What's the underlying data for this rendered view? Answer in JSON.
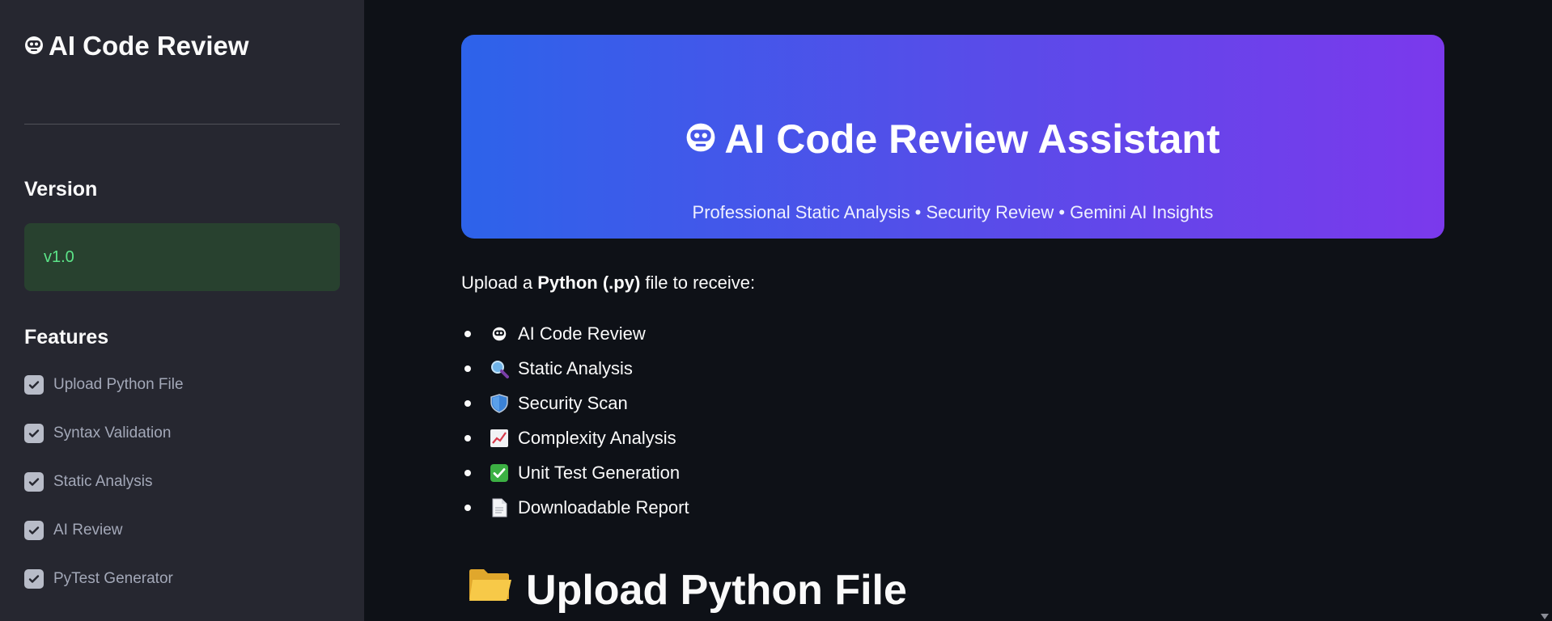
{
  "sidebar": {
    "title": "AI Code Review",
    "version_heading": "Version",
    "version_value": "v1.0",
    "features_heading": "Features",
    "features": [
      {
        "label": "Upload Python File",
        "checked": true
      },
      {
        "label": "Syntax Validation",
        "checked": true
      },
      {
        "label": "Static Analysis",
        "checked": true
      },
      {
        "label": "AI Review",
        "checked": true
      },
      {
        "label": "PyTest Generator",
        "checked": true
      }
    ]
  },
  "main": {
    "banner_title": "AI Code Review Assistant",
    "banner_subtitle": "Professional Static Analysis • Security Review • Gemini AI Insights",
    "intro_prefix": "Upload a ",
    "intro_bold": "Python (.py)",
    "intro_suffix": " file to receive:",
    "list": [
      {
        "icon": "robot-icon",
        "label": "AI Code Review"
      },
      {
        "icon": "magnifier-icon",
        "label": "Static Analysis"
      },
      {
        "icon": "shield-icon",
        "label": "Security Scan"
      },
      {
        "icon": "chart-icon",
        "label": "Complexity Analysis"
      },
      {
        "icon": "check-icon",
        "label": "Unit Test Generation"
      },
      {
        "icon": "document-icon",
        "label": "Downloadable Report"
      }
    ],
    "section_heading": "Upload Python File"
  },
  "colors": {
    "app_bg": "#0e1117",
    "sidebar_bg": "#262730",
    "version_bg": "#28412f",
    "version_text": "#5ce488",
    "banner_start": "#2d63ea",
    "banner_end": "#7b39ec"
  }
}
